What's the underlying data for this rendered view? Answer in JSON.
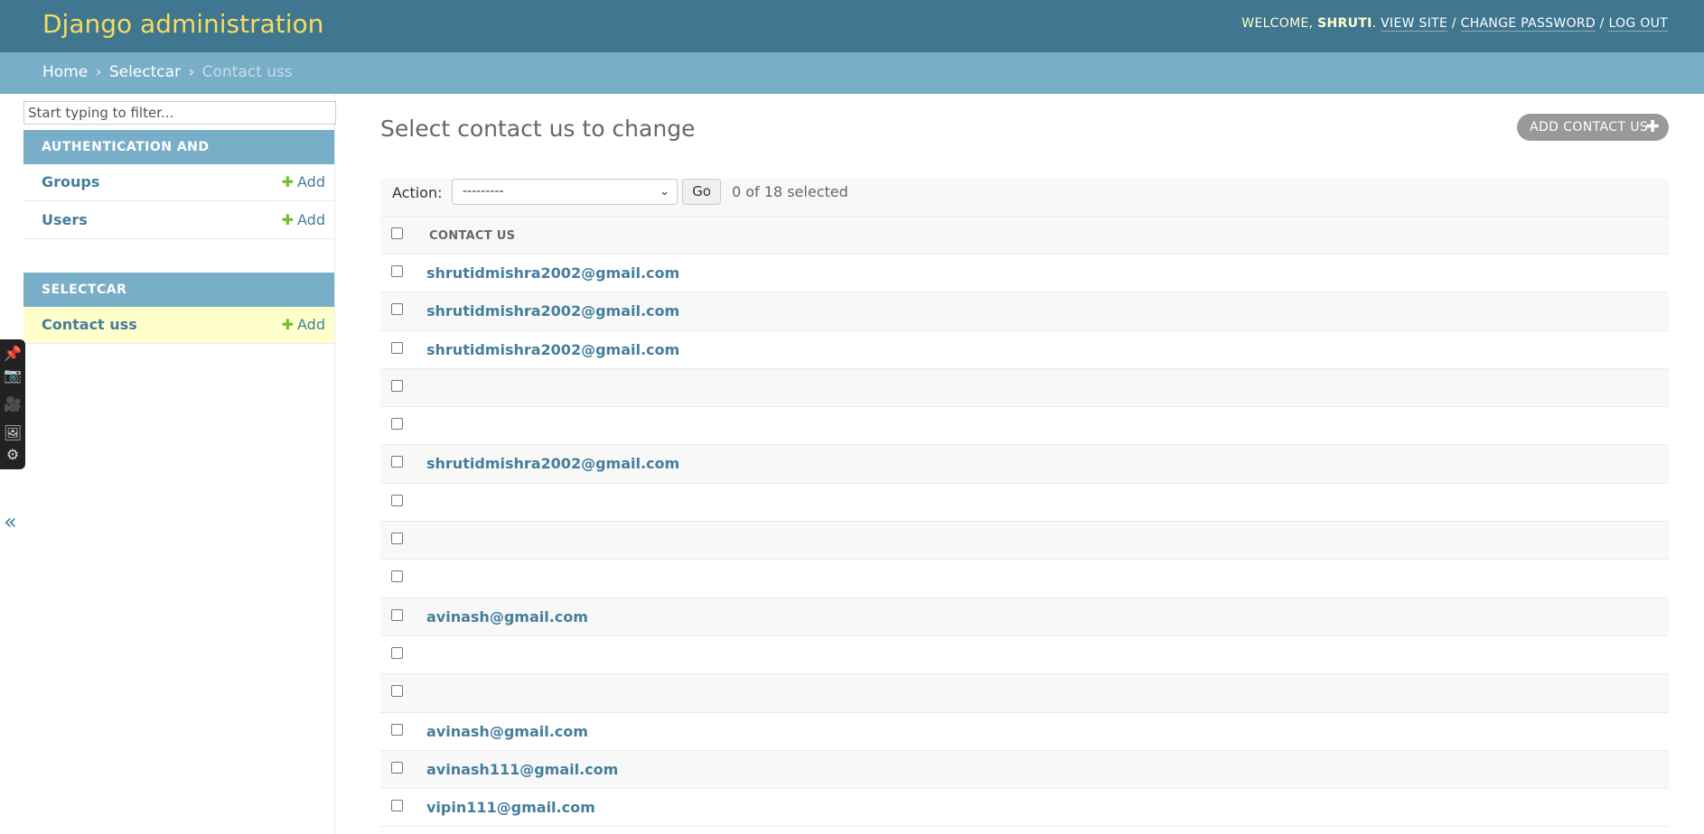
{
  "header": {
    "site_name": "Django administration",
    "welcome": "WELCOME,",
    "username": "SHRUTI",
    "view_site": "VIEW SITE",
    "change_password": "CHANGE PASSWORD",
    "log_out": "LOG OUT"
  },
  "breadcrumbs": [
    "Home",
    "Selectcar",
    "Contact uss"
  ],
  "sidebar": {
    "filter_placeholder": "Start typing to filter...",
    "collapse_icon": "«",
    "modules": [
      {
        "caption": "Authentication and Authorization",
        "models": [
          {
            "name": "Groups",
            "add": "Add"
          },
          {
            "name": "Users",
            "add": "Add"
          }
        ]
      },
      {
        "caption": "Selectcar",
        "models": [
          {
            "name": "Contact uss",
            "add": "Add"
          }
        ]
      }
    ]
  },
  "content": {
    "title": "Select contact us to change",
    "add_button": "ADD CONTACT US",
    "action_label": "Action:",
    "action_selected": "---------",
    "go_label": "Go",
    "selected_count": "0 of 18 selected",
    "column_header": "CONTACT US",
    "rows": [
      "shrutidmishra2002@gmail.com",
      "shrutidmishra2002@gmail.com",
      "shrutidmishra2002@gmail.com",
      "",
      "",
      "shrutidmishra2002@gmail.com",
      "",
      "",
      "",
      "avinash@gmail.com",
      "",
      "",
      "avinash@gmail.com",
      "avinash111@gmail.com",
      "vipin111@gmail.com"
    ]
  },
  "colors": {
    "header_bg": "#417690",
    "brand_yellow": "#f5dd5d",
    "breadcrumb_bg": "#79aec8",
    "link": "#447e9b",
    "add_green": "#70bf2b",
    "current_row": "#ffffcc"
  }
}
